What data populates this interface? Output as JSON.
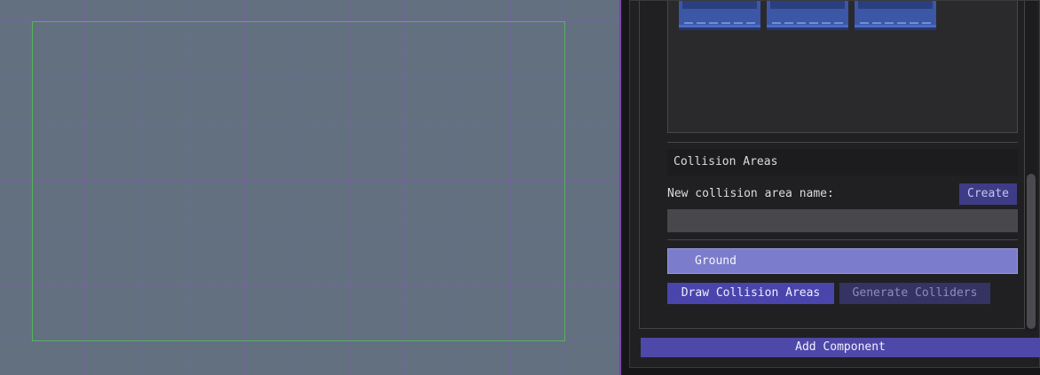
{
  "inspector": {
    "collision_section_title": "Collision Areas",
    "new_area_label": "New collision area name:",
    "create_label": "Create",
    "area_name_value": "",
    "areas": [
      {
        "name": "Ground",
        "selected": true
      }
    ],
    "draw_button_label": "Draw Collision Areas",
    "generate_button_label": "Generate Colliders",
    "add_component_label": "Add Component"
  },
  "colors": {
    "viewport_bg": "#627080",
    "grid_line": "#825aaf",
    "camera_bounds": "#53b55a",
    "accent": "#4e48a8",
    "selected_item": "#7c7ccc"
  }
}
